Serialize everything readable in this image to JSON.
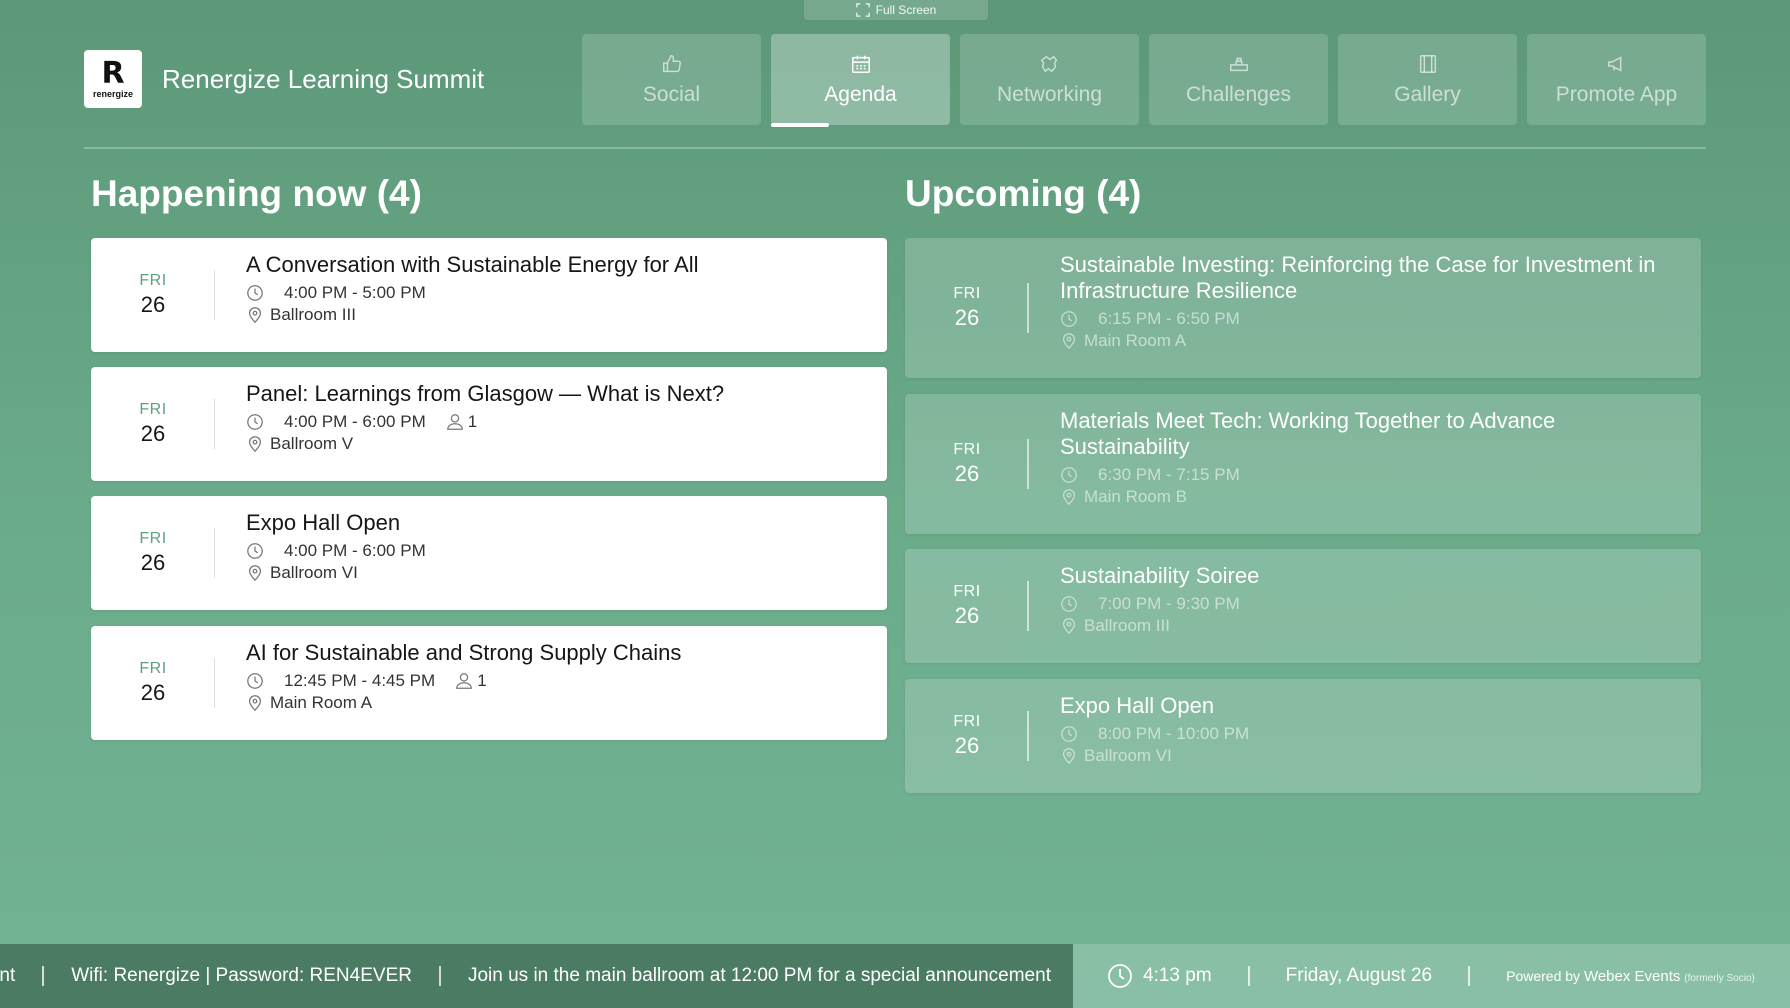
{
  "fullscreen": {
    "label": "Full Screen"
  },
  "app": {
    "title": "Renergize Learning Summit",
    "logo_text": "renergize",
    "logo_mark": "R"
  },
  "tabs": [
    {
      "label": "Social",
      "icon": "thumbs-up-icon"
    },
    {
      "label": "Agenda",
      "icon": "calendar-icon",
      "active": true
    },
    {
      "label": "Networking",
      "icon": "handshake-icon"
    },
    {
      "label": "Challenges",
      "icon": "trophy-icon"
    },
    {
      "label": "Gallery",
      "icon": "gallery-icon"
    },
    {
      "label": "Promote App",
      "icon": "megaphone-icon"
    }
  ],
  "happening_now": {
    "title": "Happening now (4)",
    "items": [
      {
        "dow": "FRI",
        "day": "26",
        "title": "A Conversation with Sustainable Energy for All",
        "time": "4:00 PM - 5:00 PM",
        "location": "Ballroom III",
        "attendees": ""
      },
      {
        "dow": "FRI",
        "day": "26",
        "title": "Panel: Learnings from Glasgow — What is Next?",
        "time": "4:00 PM - 6:00 PM",
        "location": "Ballroom V",
        "attendees": "1"
      },
      {
        "dow": "FRI",
        "day": "26",
        "title": "Expo Hall Open",
        "time": "4:00 PM - 6:00 PM",
        "location": "Ballroom VI",
        "attendees": ""
      },
      {
        "dow": "FRI",
        "day": "26",
        "title": "AI for Sustainable and Strong Supply Chains",
        "time": "12:45 PM - 4:45 PM",
        "location": "Main Room A",
        "attendees": "1"
      }
    ]
  },
  "upcoming": {
    "title": "Upcoming (4)",
    "items": [
      {
        "dow": "FRI",
        "day": "26",
        "title": "Sustainable Investing: Reinforcing the Case for Investment in Infrastructure Resilience",
        "time": "6:15 PM - 6:50 PM",
        "location": "Main Room A"
      },
      {
        "dow": "FRI",
        "day": "26",
        "title": "Materials Meet Tech: Working Together to Advance Sustainability",
        "time": "6:30 PM - 7:15 PM",
        "location": "Main Room B"
      },
      {
        "dow": "FRI",
        "day": "26",
        "title": "Sustainability Soiree",
        "time": "7:00 PM - 9:30 PM",
        "location": "Ballroom III"
      },
      {
        "dow": "FRI",
        "day": "26",
        "title": "Expo Hall Open",
        "time": "8:00 PM - 10:00 PM",
        "location": "Ballroom VI"
      }
    ]
  },
  "ticker": {
    "items": [
      "ment",
      "Wifi: Renergize | Password: REN4EVER",
      "Join us in the main ballroom at 12:00 PM for a special announcement"
    ]
  },
  "status": {
    "time": "4:13 pm",
    "date": "Friday, August 26",
    "powered_prefix": "Powered by",
    "powered_brand": "Webex Events",
    "powered_note": "(formerly Socio)"
  },
  "colors": {
    "background": "#649f80",
    "accent": "#5fa07f",
    "ticker": "#4b7b63"
  }
}
